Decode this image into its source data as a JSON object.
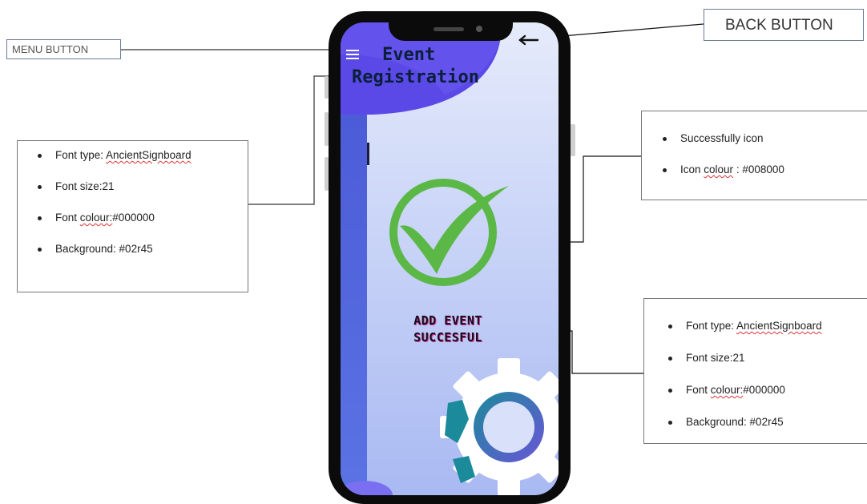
{
  "callouts": {
    "menu_button": "MENU BUTTON",
    "back_button": "BACK BUTTON"
  },
  "phone_screen": {
    "title_line1": "Event",
    "title_line2": "Registration",
    "success_line1": "ADD EVENT",
    "success_line2": "SUCCESFUL",
    "menu_icon": "hamburger-menu-icon",
    "back_icon": "back-arrow-icon",
    "success_icon": "check-circle-icon",
    "decor_icon": "gear-icon"
  },
  "title_note": {
    "items": [
      {
        "label": "Font type:  ",
        "value": "AncientSignboard"
      },
      {
        "label": "Font size:21",
        "value": ""
      },
      {
        "label": "Font ",
        "value": "colour:",
        "suffix": "#000000"
      },
      {
        "label": "Background: #02r45",
        "value": ""
      }
    ]
  },
  "icon_note": {
    "item1": "Successfully icon",
    "item2_label": "Icon ",
    "item2_word": "colour",
    "item2_suffix": " : #008000"
  },
  "text_note": {
    "items": [
      {
        "label": "Font type:  ",
        "value": "AncientSignboard"
      },
      {
        "label": "Font size:21",
        "value": ""
      },
      {
        "label": "Font ",
        "value": "colour:",
        "suffix": "#000000"
      },
      {
        "label": "Background: #02r45",
        "value": ""
      }
    ]
  },
  "colors": {
    "check_green": "#5bb847",
    "screen_accent": "#5a49e6",
    "phone_frame": "#0b0b0b"
  }
}
